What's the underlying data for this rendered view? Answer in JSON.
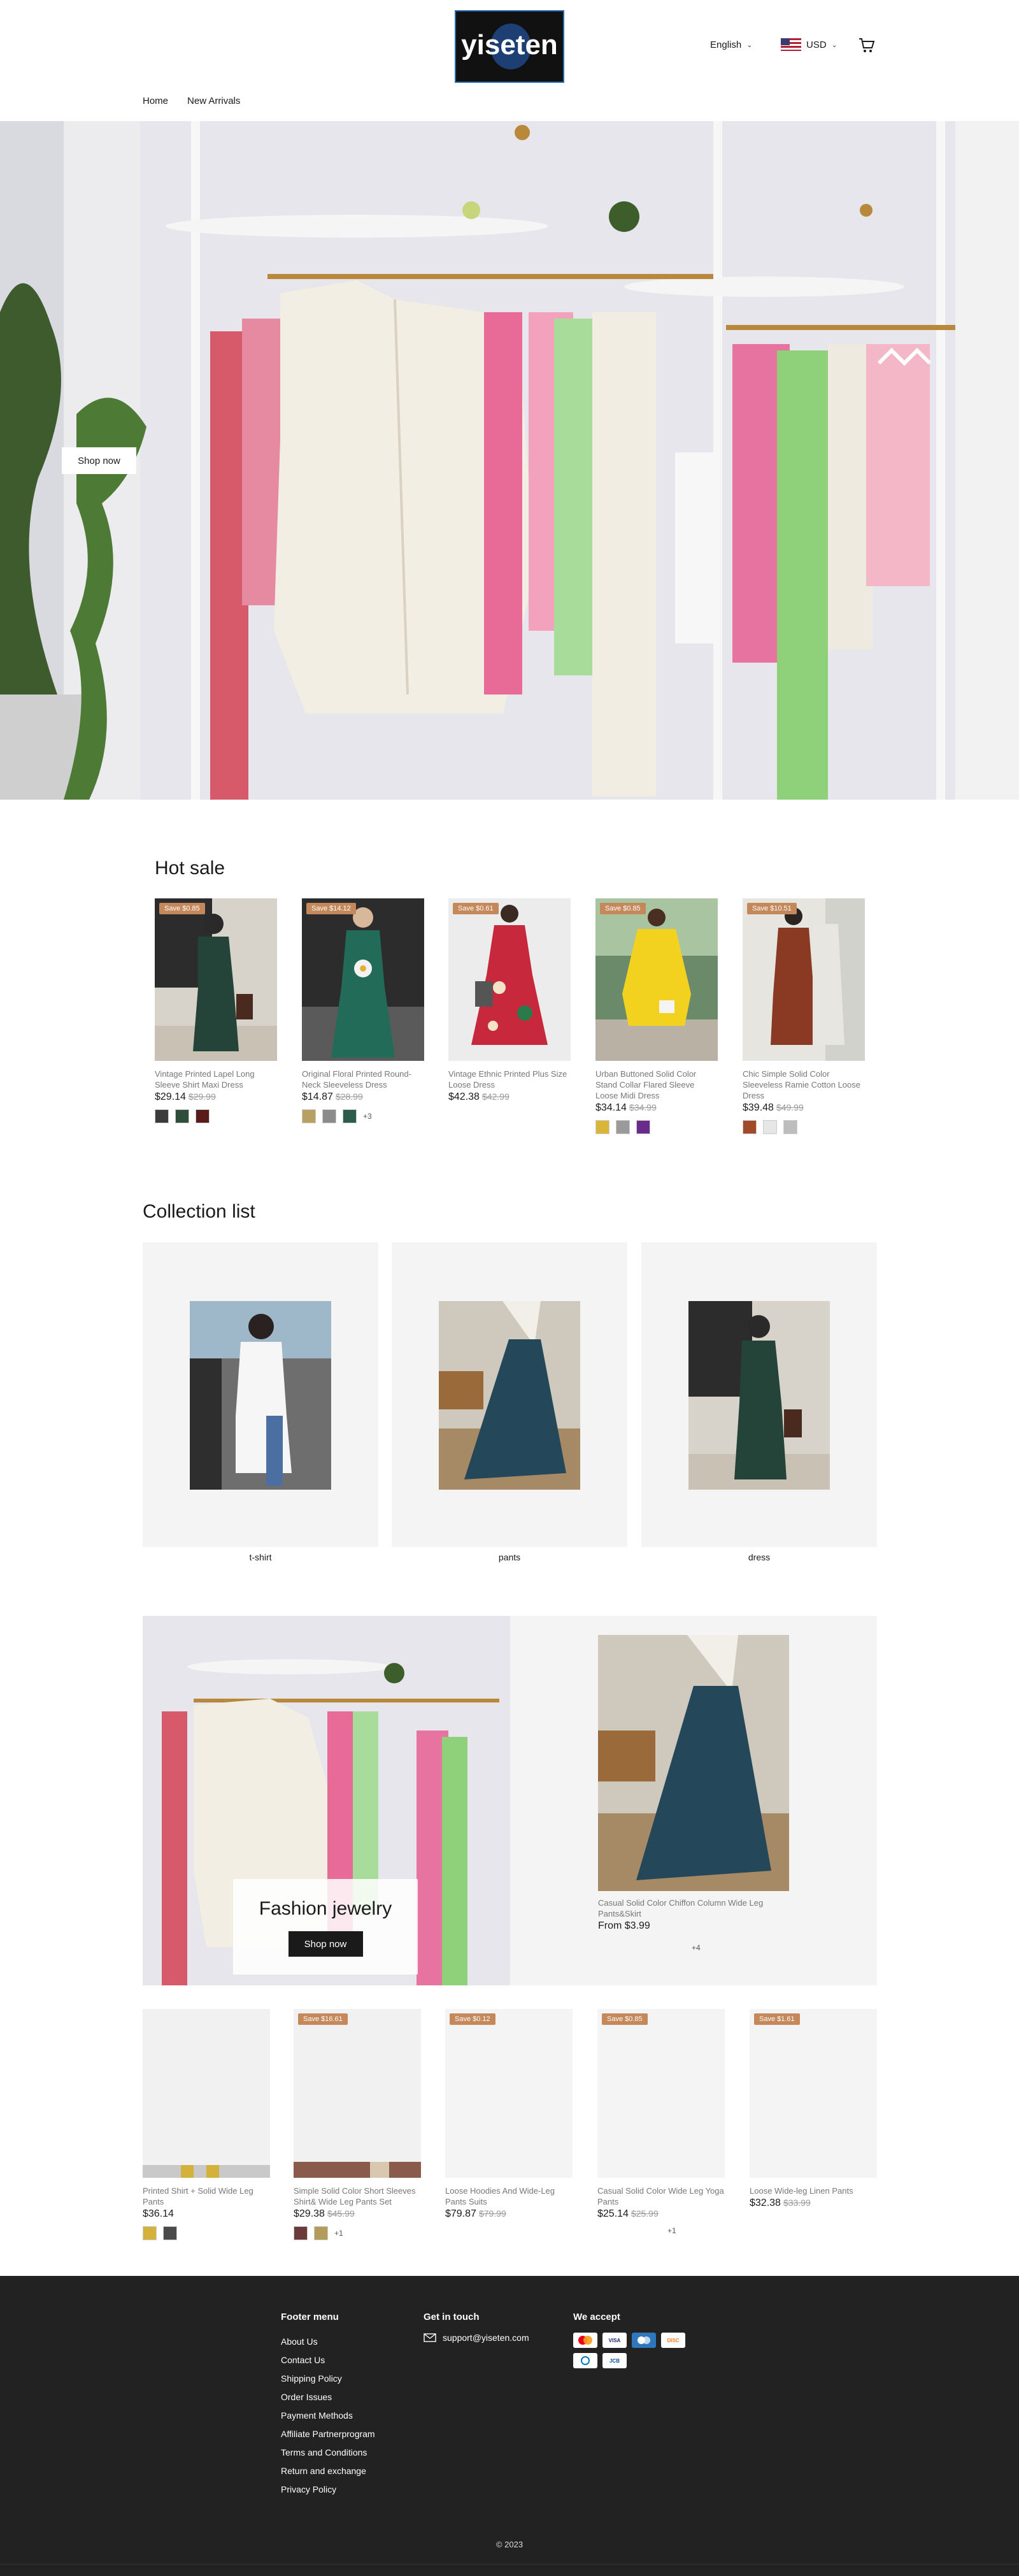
{
  "header": {
    "logo_text": "yiseten",
    "language": "English",
    "currency": "USD",
    "nav": [
      "Home",
      "New Arrivals"
    ]
  },
  "hero": {
    "button_label": "Shop now"
  },
  "hot_sale": {
    "title": "Hot sale",
    "products": [
      {
        "badge": "Save $0.85",
        "title": "Vintage Printed Lapel Long Sleeve Shirt Maxi Dress",
        "price": "$29.14",
        "old_price": "$29.99",
        "swatch_colors": [
          "#3b3b3b",
          "#2f4d3a",
          "#5a1b1b"
        ],
        "more": ""
      },
      {
        "badge": "Save $14.12",
        "title": "Original Floral Printed Round-Neck Sleeveless Dress",
        "price": "$14.87",
        "old_price": "$28.99",
        "swatch_colors": [
          "#b8a062",
          "#8b8b8b",
          "#2d5c4a"
        ],
        "more": "+3"
      },
      {
        "badge": "Save $0.61",
        "title": "Vintage Ethnic Printed Plus Size Loose Dress",
        "price": "$42.38",
        "old_price": "$42.99",
        "swatch_colors": [],
        "more": ""
      },
      {
        "badge": "Save $0.85",
        "title": "Urban Buttoned Solid Color Stand Collar Flared Sleeve Loose Midi Dress",
        "price": "$34.14",
        "old_price": "$34.99",
        "swatch_colors": [
          "#d9b53a",
          "#9a9a9a",
          "#6b2b8b"
        ],
        "more": ""
      },
      {
        "badge": "Save $10.51",
        "title": "Chic Simple Solid Color Sleeveless Ramie Cotton Loose Dress",
        "price": "$39.48",
        "old_price": "$49.99",
        "swatch_colors": [
          "#a04a2a",
          "#e6e6e6",
          "#bdbdbd"
        ],
        "more": ""
      }
    ]
  },
  "collection": {
    "title": "Collection list",
    "items": [
      "t-shirt",
      "pants",
      "dress"
    ]
  },
  "jewelry": {
    "title": "Fashion jewelry",
    "button_label": "Shop now"
  },
  "featured": {
    "title": "Casual Solid Color Chiffon Column Wide Leg Pants&Skirt",
    "price": "From $3.99",
    "more": "+4"
  },
  "row2": {
    "products": [
      {
        "badge": "",
        "title": "Printed Shirt + Solid Wide Leg Pants",
        "price": "$36.14",
        "old_price": "",
        "swatch_colors": [
          "#d4b13a",
          "#4a4a4a"
        ],
        "more": ""
      },
      {
        "badge": "Save $16.61",
        "title": "Simple Solid Color Short Sleeves Shirt& Wide Leg Pants Set",
        "price": "$29.38",
        "old_price": "$45.99",
        "swatch_colors": [
          "#6b3a3a",
          "#b39b5a"
        ],
        "more": "+1"
      },
      {
        "badge": "Save $0.12",
        "title": "Loose Hoodies And Wide-Leg Pants Suits",
        "price": "$79.87",
        "old_price": "$79.99",
        "swatch_colors": [],
        "more": ""
      },
      {
        "badge": "Save $0.85",
        "title": "Casual Solid Color Wide Leg Yoga Pants",
        "price": "$25.14",
        "old_price": "$25.99",
        "swatch_colors": [],
        "more": "+1"
      },
      {
        "badge": "Save $1.61",
        "title": "Loose Wide-leg Linen Pants",
        "price": "$32.38",
        "old_price": "$33.99",
        "swatch_colors": [],
        "more": ""
      }
    ]
  },
  "footer": {
    "menu_title": "Footer menu",
    "menu": [
      "About Us",
      "Contact Us",
      "Shipping Policy",
      "Order Issues",
      "Payment Methods",
      "Affiliate Partnerprogram",
      "Terms and Conditions",
      "Return and exchange",
      "Privacy Policy"
    ],
    "contact_title": "Get in touch",
    "email": "support@yiseten.com",
    "pay_title": "We accept",
    "payments": [
      "MC",
      "VISA",
      "AMEX",
      "DISC",
      "DC",
      "JCB"
    ],
    "copyright": "© 2023"
  },
  "colors": {
    "accent_badge": "#c5885a",
    "footer_bg": "#222222"
  }
}
